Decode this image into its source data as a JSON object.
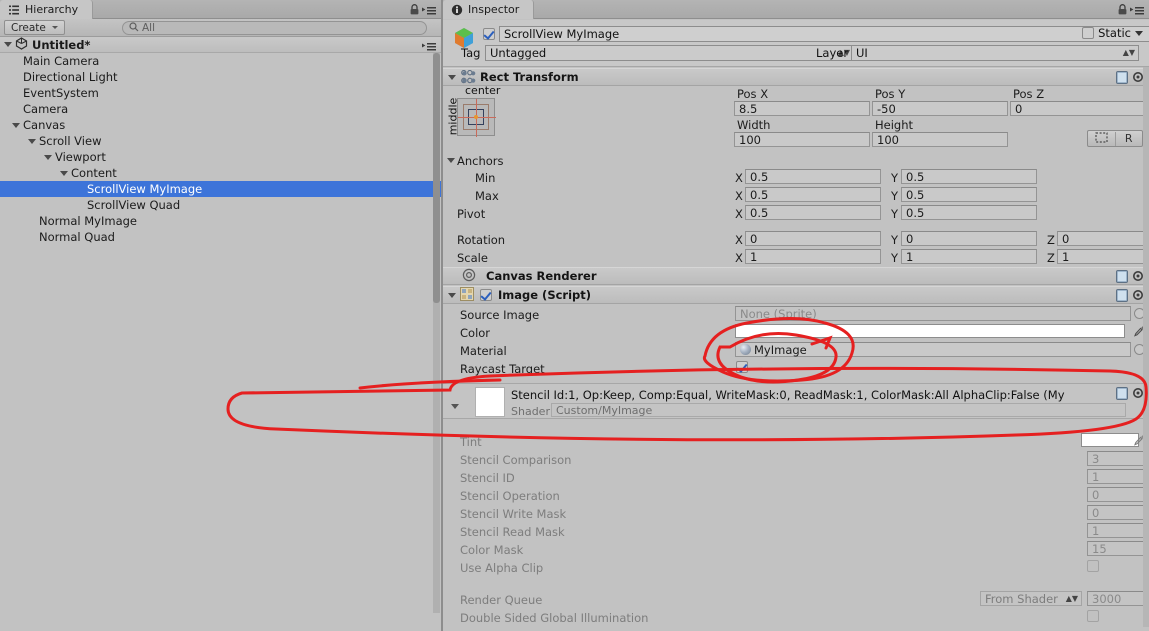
{
  "hierarchy": {
    "tab_label": "Hierarchy",
    "tab_icon": "hierarchy-icon",
    "create_label": "Create",
    "search_placeholder": "All",
    "search_value": "",
    "search_icon": "search-icon",
    "scene_name": "Untitled*",
    "nodes": [
      {
        "label": "Main Camera",
        "depth": 1,
        "caret": false,
        "selected": false
      },
      {
        "label": "Directional Light",
        "depth": 1,
        "caret": false,
        "selected": false
      },
      {
        "label": "EventSystem",
        "depth": 1,
        "caret": false,
        "selected": false
      },
      {
        "label": "Camera",
        "depth": 1,
        "caret": false,
        "selected": false
      },
      {
        "label": "Canvas",
        "depth": 1,
        "caret": true,
        "selected": false
      },
      {
        "label": "Scroll View",
        "depth": 2,
        "caret": true,
        "selected": false
      },
      {
        "label": "Viewport",
        "depth": 3,
        "caret": true,
        "selected": false
      },
      {
        "label": "Content",
        "depth": 4,
        "caret": true,
        "selected": false
      },
      {
        "label": "ScrollView MyImage",
        "depth": 5,
        "caret": false,
        "selected": true
      },
      {
        "label": "ScrollView Quad",
        "depth": 5,
        "caret": false,
        "selected": false
      },
      {
        "label": "Normal MyImage",
        "depth": 2,
        "caret": false,
        "selected": false
      },
      {
        "label": "Normal Quad",
        "depth": 2,
        "caret": false,
        "selected": false
      }
    ]
  },
  "inspector": {
    "tab_label": "Inspector",
    "tab_icon": "info-icon",
    "object_name": "ScrollView MyImage",
    "object_enabled": true,
    "static_label": "Static",
    "static_checked": false,
    "tag_label": "Tag",
    "tag_value": "Untagged",
    "layer_label": "Layer",
    "layer_value": "UI",
    "rect_transform": {
      "title": "Rect Transform",
      "anchor_h_label": "center",
      "anchor_v_label": "middle",
      "pos_x_label": "Pos X",
      "pos_y_label": "Pos Y",
      "pos_z_label": "Pos Z",
      "pos_x": "8.5",
      "pos_y": "-50",
      "pos_z": "0",
      "width_label": "Width",
      "height_label": "Height",
      "width": "100",
      "height": "100",
      "blueprint_btn": "blueprint-icon",
      "raw_btn": "R",
      "anchors_label": "Anchors",
      "min_label": "Min",
      "max_label": "Max",
      "pivot_label": "Pivot",
      "min_x": "0.5",
      "min_y": "0.5",
      "max_x": "0.5",
      "max_y": "0.5",
      "pivot_x": "0.5",
      "pivot_y": "0.5",
      "rotation_label": "Rotation",
      "rot_x": "0",
      "rot_y": "0",
      "rot_z": "0",
      "scale_label": "Scale",
      "scale_x": "1",
      "scale_y": "1",
      "scale_z": "1",
      "axis_x": "X",
      "axis_y": "Y",
      "axis_z": "Z"
    },
    "canvas_renderer": {
      "title": "Canvas Renderer"
    },
    "image_script": {
      "title": "Image (Script)",
      "enabled": true,
      "source_image_label": "Source Image",
      "source_image_value": "None (Sprite)",
      "color_label": "Color",
      "color_value": "#FFFFFF",
      "material_label": "Material",
      "material_value": "MyImage",
      "raycast_label": "Raycast Target",
      "raycast_checked": true
    },
    "material_block": {
      "summary": "Stencil Id:1, Op:Keep, Comp:Equal, WriteMask:0, ReadMask:1, ColorMask:All AlphaClip:False (My",
      "shader_label": "Shader",
      "shader_value": "Custom/MyImage",
      "properties": [
        {
          "label": "Tint",
          "value": "",
          "type": "color"
        },
        {
          "label": "Stencil Comparison",
          "value": "3",
          "type": "number"
        },
        {
          "label": "Stencil ID",
          "value": "1",
          "type": "number"
        },
        {
          "label": "Stencil Operation",
          "value": "0",
          "type": "number"
        },
        {
          "label": "Stencil Write Mask",
          "value": "0",
          "type": "number"
        },
        {
          "label": "Stencil Read Mask",
          "value": "1",
          "type": "number"
        },
        {
          "label": "Color Mask",
          "value": "15",
          "type": "number"
        },
        {
          "label": "Use Alpha Clip",
          "value": "",
          "type": "checkbox"
        }
      ],
      "render_queue_label": "Render Queue",
      "render_queue_mode": "From Shader",
      "render_queue_value": "3000",
      "double_sided_label": "Double Sided Global Illumination",
      "double_sided_checked": false,
      "tint_color": "#FFFFFF"
    }
  },
  "annotations": {
    "color": "#e52020",
    "shapes": [
      "ellipse-around-material-and-raycast",
      "large-ellipse-around-material-block"
    ]
  }
}
